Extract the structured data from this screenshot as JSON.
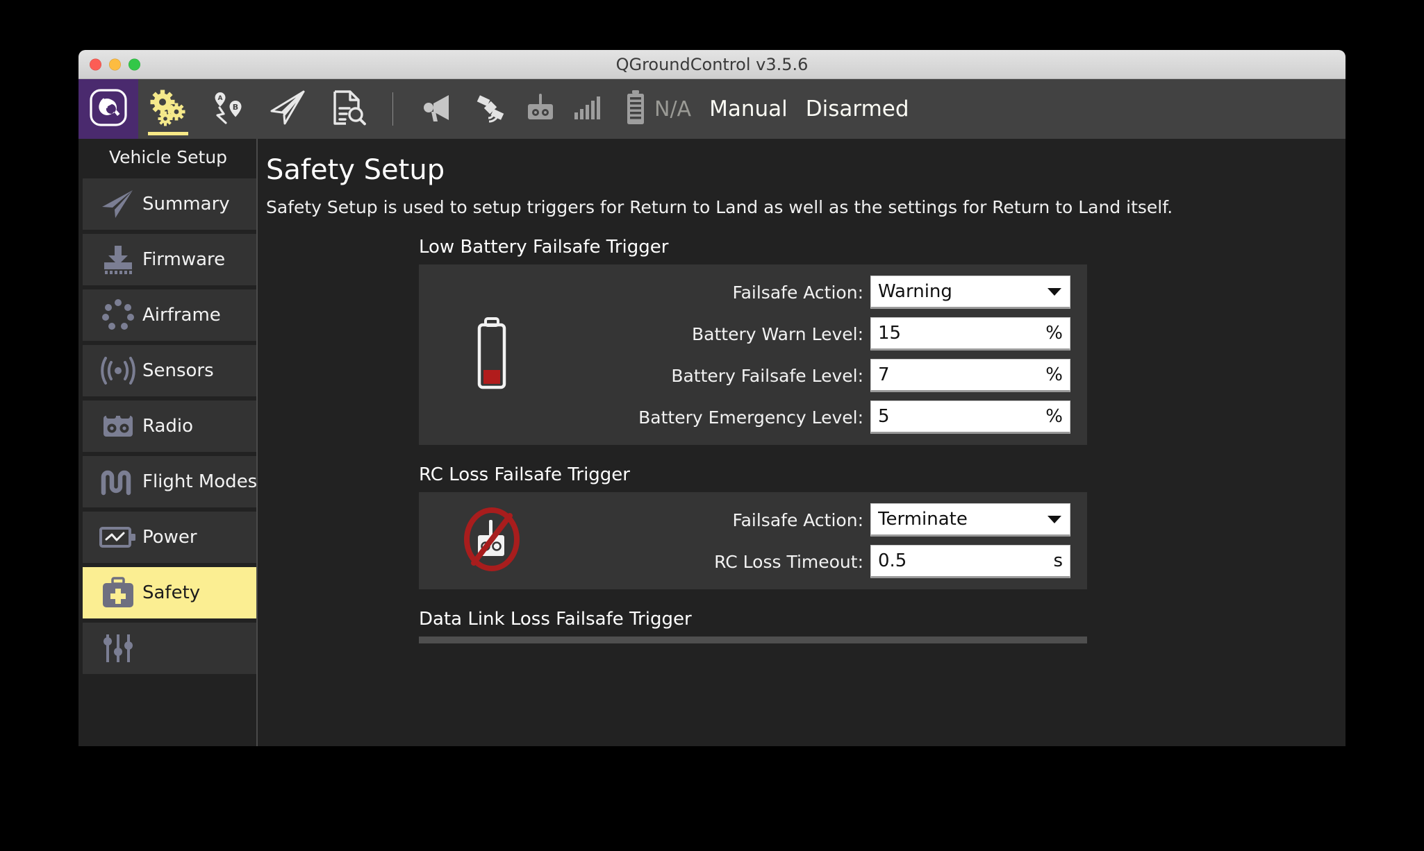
{
  "window": {
    "title": "QGroundControl v3.5.6",
    "traffic_lights": [
      "close-button",
      "minimize-button",
      "zoom-button"
    ],
    "colors": {
      "close": "#fc5d55",
      "minimize": "#fdbc40",
      "zoom": "#33c748",
      "accent_yellow": "#fbee92",
      "logo_purple": "#4a2a6e",
      "panel_bg": "#353535",
      "content_bg": "#222222",
      "toolbar_bg": "#424242"
    }
  },
  "toolbar": {
    "buttons": [
      {
        "icon": "qgc-logo-icon",
        "label": "QGroundControl",
        "active": false,
        "is_logo": true
      },
      {
        "icon": "gears-icon",
        "label": "Vehicle Setup",
        "active": true,
        "is_logo": false
      },
      {
        "icon": "waypoints-ab-icon",
        "label": "Plan",
        "active": false,
        "is_logo": false
      },
      {
        "icon": "paper-plane-icon",
        "label": "Fly",
        "active": false,
        "is_logo": false
      },
      {
        "icon": "document-search-icon",
        "label": "Analyze",
        "active": false,
        "is_logo": false
      }
    ],
    "status": {
      "megaphone_icon": "megaphone-icon",
      "satellite_icon": "satellite-icon",
      "rc_icon": "rc-controller-icon",
      "signal_icon": "signal-bars-icon",
      "battery_icon": "battery-icon",
      "battery_value": "N/A",
      "flight_mode": "Manual",
      "arm_state": "Disarmed"
    }
  },
  "sidebar": {
    "title": "Vehicle Setup",
    "items": [
      {
        "label": "Summary",
        "icon": "paper-plane-icon",
        "selected": false
      },
      {
        "label": "Firmware",
        "icon": "download-icon",
        "selected": false
      },
      {
        "label": "Airframe",
        "icon": "airframe-icon",
        "selected": false
      },
      {
        "label": "Sensors",
        "icon": "sensors-icon",
        "selected": false
      },
      {
        "label": "Radio",
        "icon": "rc-controller-icon",
        "selected": false
      },
      {
        "label": "Flight Modes",
        "icon": "flight-modes-icon",
        "selected": false
      },
      {
        "label": "Power",
        "icon": "power-icon",
        "selected": false
      },
      {
        "label": "Safety",
        "icon": "safety-kit-icon",
        "selected": true
      },
      {
        "label": "",
        "icon": "tuning-sliders-icon",
        "selected": false
      }
    ]
  },
  "main": {
    "title": "Safety Setup",
    "description": "Safety Setup is used to setup triggers for Return to Land as well as the settings for Return to Land itself.",
    "sections": [
      {
        "heading": "Low Battery Failsafe Trigger",
        "icon": "low-battery-icon",
        "rows": [
          {
            "label": "Failsafe Action:",
            "value": "Warning",
            "unit": "",
            "type": "dropdown"
          },
          {
            "label": "Battery Warn Level:",
            "value": "15",
            "unit": "%",
            "type": "text"
          },
          {
            "label": "Battery Failsafe Level:",
            "value": "7",
            "unit": "%",
            "type": "text"
          },
          {
            "label": "Battery Emergency Level:",
            "value": "5",
            "unit": "%",
            "type": "text"
          }
        ]
      },
      {
        "heading": "RC Loss Failsafe Trigger",
        "icon": "rc-loss-icon",
        "rows": [
          {
            "label": "Failsafe Action:",
            "value": "Terminate",
            "unit": "",
            "type": "dropdown"
          },
          {
            "label": "RC Loss Timeout:",
            "value": "0.5",
            "unit": "s",
            "type": "text"
          }
        ]
      }
    ],
    "next_section_heading": "Data Link Loss Failsafe Trigger"
  }
}
